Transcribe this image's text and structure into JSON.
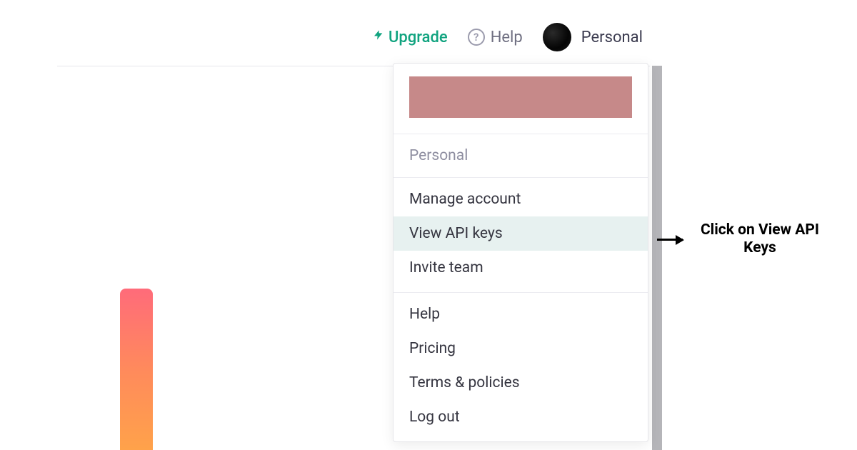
{
  "topbar": {
    "upgrade_label": "Upgrade",
    "help_label": "Help",
    "account_label": "Personal"
  },
  "dropdown": {
    "workspace_label": "Personal",
    "items_account": [
      "Manage account",
      "View API keys",
      "Invite team"
    ],
    "items_misc": [
      "Help",
      "Pricing",
      "Terms & policies",
      "Log out"
    ],
    "highlighted_index": 1
  },
  "annotation": {
    "text": "Click on View API Keys"
  }
}
